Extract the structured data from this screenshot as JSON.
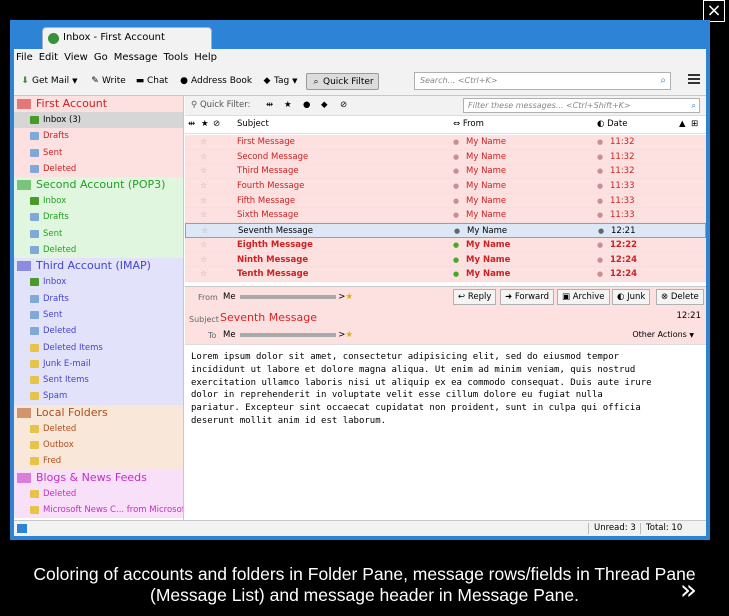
{
  "window": {
    "tab_title": "Inbox - First Account",
    "close_glyph": "×"
  },
  "menu": [
    "File",
    "Edit",
    "View",
    "Go",
    "Message",
    "Tools",
    "Help"
  ],
  "toolbar": {
    "get_mail": "Get Mail",
    "write": "Write",
    "chat": "Chat",
    "address_book": "Address Book",
    "tag": "Tag",
    "quick_filter": "Quick Filter",
    "search_placeholder": "Search... <Ctrl+K>"
  },
  "folder_pane": {
    "accounts": [
      {
        "name": "First Account",
        "color": "#cc2222",
        "bg": "#fde0e0",
        "folders": [
          "Inbox (3)",
          "Drafts",
          "Sent",
          "Deleted"
        ]
      },
      {
        "name": "Second Account (POP3)",
        "color": "#22a022",
        "bg": "#e0f6df",
        "folders": [
          "Inbox",
          "Drafts",
          "Sent",
          "Deleted"
        ]
      },
      {
        "name": "Third Account (IMAP)",
        "color": "#4444cc",
        "bg": "#e2e2fb",
        "folders": [
          "Inbox",
          "Drafts",
          "Sent",
          "Deleted",
          "Deleted Items",
          "Junk E-mail",
          "Sent Items",
          "Spam"
        ]
      },
      {
        "name": "Local Folders",
        "color": "#b24c18",
        "bg": "#f9e8da",
        "folders": [
          "Deleted",
          "Outbox",
          "Fred"
        ]
      },
      {
        "name": "Blogs & News Feeds",
        "color": "#c030c0",
        "bg": "#f9e0f9",
        "folders": [
          "Deleted",
          "Microsoft News C... from Microsoft"
        ]
      }
    ]
  },
  "thread_pane": {
    "quick_filter_label": "Quick Filter:",
    "filter_placeholder": "Filter these messages... <Ctrl+Shift+K>",
    "columns": {
      "subject": "Subject",
      "from": "From",
      "date": "Date"
    },
    "rows": [
      {
        "subject": "First Message",
        "from": "My Name",
        "date": "11:32",
        "unread": false,
        "selected": false
      },
      {
        "subject": "Second Message",
        "from": "My Name",
        "date": "11:32",
        "unread": false,
        "selected": false
      },
      {
        "subject": "Third Message",
        "from": "My Name",
        "date": "11:32",
        "unread": false,
        "selected": false
      },
      {
        "subject": "Fourth Message",
        "from": "My Name",
        "date": "11:33",
        "unread": false,
        "selected": false
      },
      {
        "subject": "Fifth Message",
        "from": "My Name",
        "date": "11:33",
        "unread": false,
        "selected": false
      },
      {
        "subject": "Sixth Message",
        "from": "My Name",
        "date": "11:33",
        "unread": false,
        "selected": false
      },
      {
        "subject": "Seventh Message",
        "from": "My Name",
        "date": "12:21",
        "unread": false,
        "selected": true
      },
      {
        "subject": "Eighth Message",
        "from": "My Name",
        "date": "12:22",
        "unread": true,
        "selected": false
      },
      {
        "subject": "Ninth Message",
        "from": "My Name",
        "date": "12:24",
        "unread": true,
        "selected": false
      },
      {
        "subject": "Tenth Message",
        "from": "My Name",
        "date": "12:24",
        "unread": true,
        "selected": false
      }
    ]
  },
  "message": {
    "from_label": "From",
    "from_value": "Me",
    "subject_label": "Subject",
    "subject": "Seventh Message",
    "to_label": "To",
    "to_value": "Me",
    "time": "12:21",
    "buttons": {
      "reply": "Reply",
      "forward": "Forward",
      "archive": "Archive",
      "junk": "Junk",
      "delete": "Delete"
    },
    "other_actions": "Other Actions",
    "body": "Lorem ipsum dolor sit amet, consectetur adipisicing elit, sed do eiusmod tempor\nincididunt ut labore et dolore magna aliqua. Ut enim ad minim veniam, quis nostrud\nexercitation ullamco laboris nisi ut aliquip ex ea commodo consequat. Duis aute irure\ndolor in reprehenderit in voluptate velit esse cillum dolore eu fugiat nulla\npariatur. Excepteur sint occaecat cupidatat non proident, sunt in culpa qui officia\ndeserunt mollit anim id est laborum."
  },
  "status": {
    "unread": "Unread: 3",
    "total": "Total: 10"
  },
  "caption": "Coloring of accounts and folders in Folder Pane, message rows/fields in Thread Pane (Message List) and message header in Message Pane.",
  "next_glyph": "»",
  "colors": {
    "window_frame": "#2d84d6",
    "red_text": "#cc2222",
    "red_row_bg": "#fde0e0",
    "selected_row_bg": "#dce8f6",
    "green_dot": "#44aa22"
  }
}
